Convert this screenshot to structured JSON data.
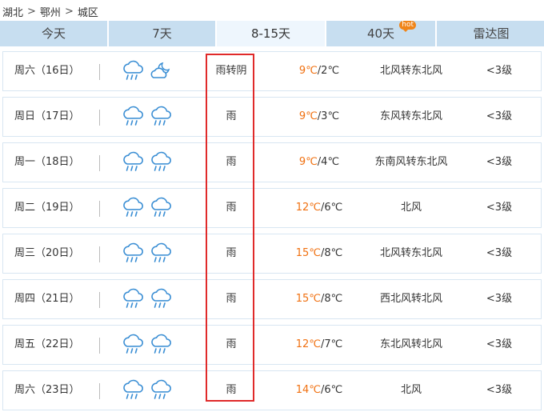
{
  "breadcrumb": [
    "湖北",
    "鄂州",
    "城区"
  ],
  "breadcrumb_sep": ">",
  "tabs": [
    {
      "label": "今天"
    },
    {
      "label": "7天"
    },
    {
      "label": "8-15天",
      "active": true
    },
    {
      "label": "40天",
      "badge": "hot"
    },
    {
      "label": "雷达图"
    }
  ],
  "colors": {
    "high_temp": "#f07010",
    "tab_bg": "#c7def0",
    "tab_active_bg": "#eef6fd",
    "highlight_box": "#e02a2a",
    "badge": "#f08519"
  },
  "days": [
    {
      "day": "周六（16日）",
      "icons": [
        "rain-cloud-icon",
        "partly-cloudy-night-icon"
      ],
      "desc": "雨转阴",
      "high": "9℃",
      "low": "/2℃",
      "wind": "北风转东北风",
      "level": "<3级"
    },
    {
      "day": "周日（17日）",
      "icons": [
        "rain-cloud-icon",
        "rain-cloud-icon"
      ],
      "desc": "雨",
      "high": "9℃",
      "low": "/3℃",
      "wind": "东风转东北风",
      "level": "<3级"
    },
    {
      "day": "周一（18日）",
      "icons": [
        "rain-cloud-icon",
        "rain-cloud-icon"
      ],
      "desc": "雨",
      "high": "9℃",
      "low": "/4℃",
      "wind": "东南风转东北风",
      "level": "<3级"
    },
    {
      "day": "周二（19日）",
      "icons": [
        "rain-cloud-icon",
        "rain-cloud-icon"
      ],
      "desc": "雨",
      "high": "12℃",
      "low": "/6℃",
      "wind": "北风",
      "level": "<3级"
    },
    {
      "day": "周三（20日）",
      "icons": [
        "rain-cloud-icon",
        "rain-cloud-icon"
      ],
      "desc": "雨",
      "high": "15℃",
      "low": "/8℃",
      "wind": "北风转东北风",
      "level": "<3级"
    },
    {
      "day": "周四（21日）",
      "icons": [
        "rain-cloud-icon",
        "rain-cloud-icon"
      ],
      "desc": "雨",
      "high": "15℃",
      "low": "/8℃",
      "wind": "西北风转北风",
      "level": "<3级"
    },
    {
      "day": "周五（22日）",
      "icons": [
        "rain-cloud-icon",
        "rain-cloud-icon"
      ],
      "desc": "雨",
      "high": "12℃",
      "low": "/7℃",
      "wind": "东北风转北风",
      "level": "<3级"
    },
    {
      "day": "周六（23日）",
      "icons": [
        "rain-cloud-icon",
        "rain-cloud-icon"
      ],
      "desc": "雨",
      "high": "14℃",
      "low": "/6℃",
      "wind": "北风",
      "level": "<3级"
    }
  ]
}
